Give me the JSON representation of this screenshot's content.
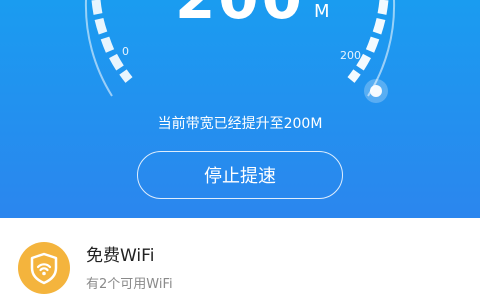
{
  "speed_panel": {
    "speed_value": "200",
    "speed_unit": "M",
    "scale_min_label": "0",
    "scale_max_label": "200",
    "bandwidth_message": "当前带宽已经提升至200M",
    "stop_button_label": "停止提速"
  },
  "wifi_card": {
    "icon": "shield-wifi-icon",
    "title": "免费WiFi",
    "subtitle": "有2个可用WiFi"
  },
  "colors": {
    "hero_top": "#1a9cf0",
    "hero_bottom": "#2b86ee",
    "wifi_icon_bg": "#f4b43d"
  }
}
